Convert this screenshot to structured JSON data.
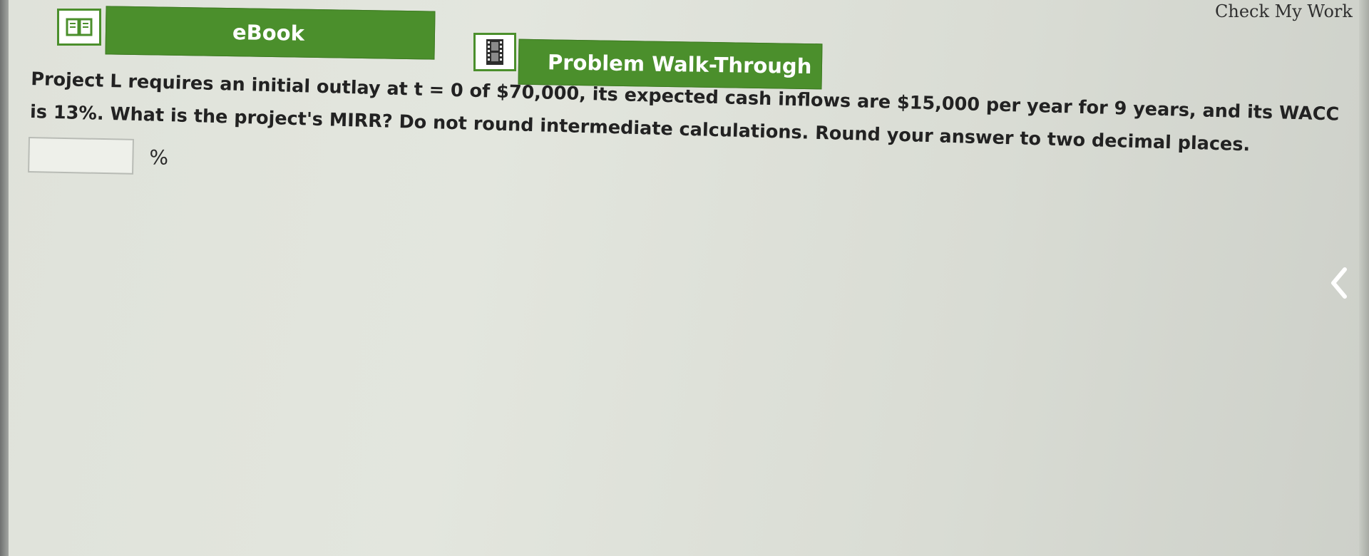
{
  "header": {
    "check_my_work": "Check My Work"
  },
  "tabs": [
    {
      "label": "eBook",
      "icon": "book-icon"
    },
    {
      "label": "Problem Walk-Through",
      "icon": "film-icon"
    }
  ],
  "problem": {
    "text": "Project L requires an initial outlay at t = 0 of $70,000, its expected cash inflows are $15,000 per year for 9 years, and its WACC is 13%. What is the project's MIRR? Do not round intermediate calculations. Round your answer to two decimal places."
  },
  "answer": {
    "value": "",
    "unit": "%"
  },
  "colors": {
    "tab_green": "#4b8f2c",
    "background": "#e0e3db"
  },
  "nav": {
    "icon": "chevron-left-icon"
  }
}
